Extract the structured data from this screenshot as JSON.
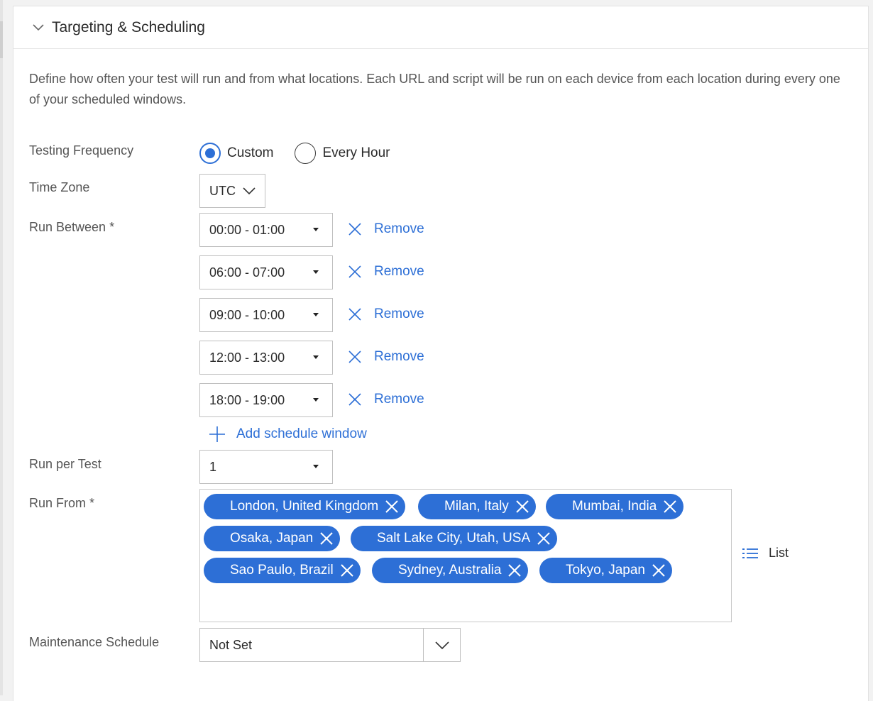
{
  "section": {
    "title": "Targeting & Scheduling",
    "description": "Define how often your test will run and from what locations. Each URL and script will be run on each device from each location during every one of your scheduled windows."
  },
  "labels": {
    "frequency": "Testing Frequency",
    "timezone": "Time Zone",
    "run_between": "Run Between *",
    "run_per_test": "Run per Test",
    "run_from": "Run From *",
    "maintenance": "Maintenance Schedule"
  },
  "frequency": {
    "options": [
      {
        "label": "Custom",
        "selected": true
      },
      {
        "label": "Every Hour",
        "selected": false
      }
    ]
  },
  "timezone": {
    "value": "UTC"
  },
  "windows": [
    {
      "value": "00:00 - 01:00",
      "remove_label": "Remove"
    },
    {
      "value": "06:00 - 07:00",
      "remove_label": "Remove"
    },
    {
      "value": "09:00 - 10:00",
      "remove_label": "Remove"
    },
    {
      "value": "12:00 - 13:00",
      "remove_label": "Remove"
    },
    {
      "value": "18:00 - 19:00",
      "remove_label": "Remove"
    }
  ],
  "add_window_label": "Add schedule window",
  "run_per_test": {
    "value": "1"
  },
  "locations": [
    "London, United Kingdom",
    "Milan, Italy",
    "Mumbai, India",
    "Osaka, Japan",
    "Salt Lake City, Utah, USA",
    "Sao Paulo, Brazil",
    "Sydney, Australia",
    "Tokyo, Japan"
  ],
  "list_label": "List",
  "maintenance": {
    "value": "Not Set"
  },
  "colors": {
    "accent": "#2d6fd6",
    "tag_bg": "#2d6fd6",
    "label": "#555555"
  },
  "icons": {
    "header": "chevron-down-icon",
    "remove": "close-icon",
    "add": "plus-icon",
    "list": "list-icon",
    "tag_remove": "close-icon",
    "maintenance_toggle": "chevron-down-icon"
  }
}
